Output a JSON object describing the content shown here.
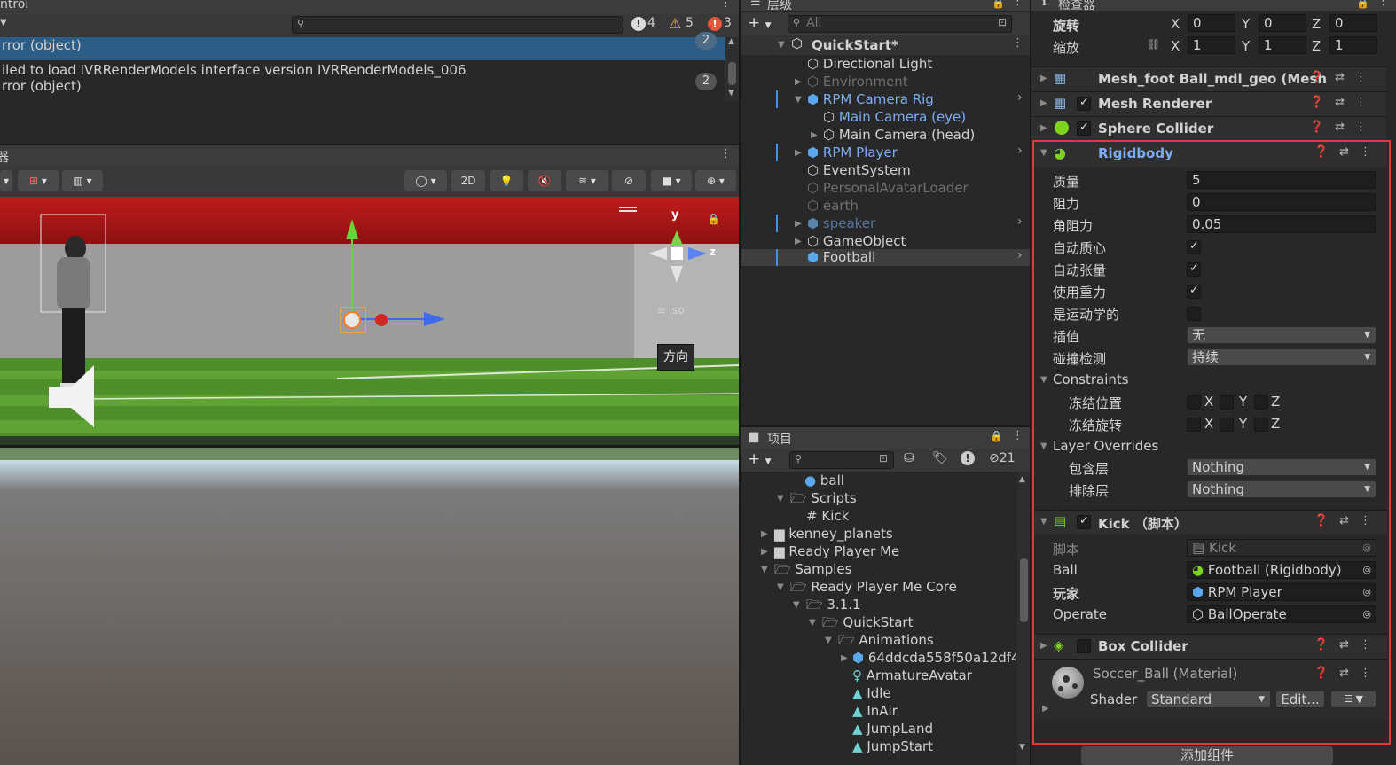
{
  "console": {
    "title_fragment": "ntrol",
    "search_placeholder": "",
    "counts": {
      "info": "4",
      "warn": "5",
      "error": "3"
    },
    "rows": [
      {
        "line1": "",
        "line2": "rror (object)",
        "count": "2"
      },
      {
        "line1": "iled to load IVRRenderModels interface version IVRRenderModels_006",
        "line2": "rror (object)",
        "count": "2"
      }
    ]
  },
  "scene": {
    "tab_fragment": "器",
    "btn_2d": "2D",
    "iso_label": "≡ iso",
    "axis_y": "y",
    "axis_z": "z",
    "tooltip": "方向"
  },
  "hierarchy": {
    "tab_label": "层级",
    "search_placeholder": "All",
    "items": [
      {
        "label": "QuickStart*",
        "depth": 0,
        "style": "root"
      },
      {
        "label": "Directional Light",
        "depth": 1,
        "style": "normal"
      },
      {
        "label": "Environment",
        "depth": 1,
        "style": "dim"
      },
      {
        "label": "RPM Camera Rig",
        "depth": 1,
        "style": "blue"
      },
      {
        "label": "Main Camera (eye)",
        "depth": 2,
        "style": "blue"
      },
      {
        "label": "Main Camera (head)",
        "depth": 2,
        "style": "normal"
      },
      {
        "label": "RPM Player",
        "depth": 1,
        "style": "blue"
      },
      {
        "label": "EventSystem",
        "depth": 1,
        "style": "normal"
      },
      {
        "label": "PersonalAvatarLoader",
        "depth": 1,
        "style": "dim"
      },
      {
        "label": "earth",
        "depth": 1,
        "style": "dim"
      },
      {
        "label": "speaker",
        "depth": 1,
        "style": "dimblue"
      },
      {
        "label": "GameObject",
        "depth": 1,
        "style": "normal"
      },
      {
        "label": "Football",
        "depth": 1,
        "style": "selected"
      }
    ]
  },
  "project": {
    "tab_label": "项目",
    "hidden_count": "21",
    "items": [
      {
        "label": "ball"
      },
      {
        "label": "Scripts"
      },
      {
        "label": "Kick"
      },
      {
        "label": "kenney_planets"
      },
      {
        "label": "Ready Player Me"
      },
      {
        "label": "Samples"
      },
      {
        "label": "Ready Player Me Core"
      },
      {
        "label": "3.1.1"
      },
      {
        "label": "QuickStart"
      },
      {
        "label": "Animations"
      },
      {
        "label": "64ddcda558f50a12df4"
      },
      {
        "label": "ArmatureAvatar"
      },
      {
        "label": "Idle"
      },
      {
        "label": "InAir"
      },
      {
        "label": "JumpLand"
      },
      {
        "label": "JumpStart"
      }
    ]
  },
  "inspector": {
    "tab_label": "检查器",
    "rotation": {
      "label": "旋转",
      "x": "0",
      "y": "0",
      "z": "0"
    },
    "scale": {
      "label": "缩放",
      "x": "1",
      "y": "1",
      "z": "1"
    },
    "axis": {
      "x": "X",
      "y": "Y",
      "z": "Z"
    },
    "components": {
      "mesh_filter": "Mesh_foot Ball_mdl_geo (Mesh",
      "mesh_renderer": "Mesh Renderer",
      "sphere_collider": "Sphere Collider",
      "rigidbody": "Rigidbody",
      "kick": "Kick （脚本）",
      "box_collider": "Box Collider"
    },
    "rigidbody": {
      "mass_label": "质量",
      "mass": "5",
      "drag_label": "阻力",
      "drag": "0",
      "angular_drag_label": "角阻力",
      "angular_drag": "0.05",
      "auto_com_label": "自动质心",
      "auto_tensor_label": "自动张量",
      "gravity_label": "使用重力",
      "kinematic_label": "是运动学的",
      "interp_label": "插值",
      "interp": "无",
      "collision_label": "碰撞检测",
      "collision": "持续",
      "constraints_label": "Constraints",
      "freeze_pos_label": "冻结位置",
      "freeze_rot_label": "冻结旋转",
      "layer_overrides_label": "Layer Overrides",
      "include_label": "包含层",
      "include": "Nothing",
      "exclude_label": "排除层",
      "exclude": "Nothing"
    },
    "kick": {
      "script_label": "脚本",
      "script": "Kick",
      "ball_label": "Ball",
      "ball": "Football (Rigidbody)",
      "player_label": "玩家",
      "player": "RPM Player",
      "operate_label": "Operate",
      "operate": "BallOperate"
    },
    "material": {
      "name": "Soccer_Ball (Material)",
      "shader_label": "Shader",
      "shader": "Standard",
      "edit": "Edit..."
    },
    "add_component": "添加组件"
  },
  "colors": {
    "highlight_red": "#e0383b",
    "selection_blue": "#2c5d87",
    "link_blue": "#7cadf4"
  }
}
